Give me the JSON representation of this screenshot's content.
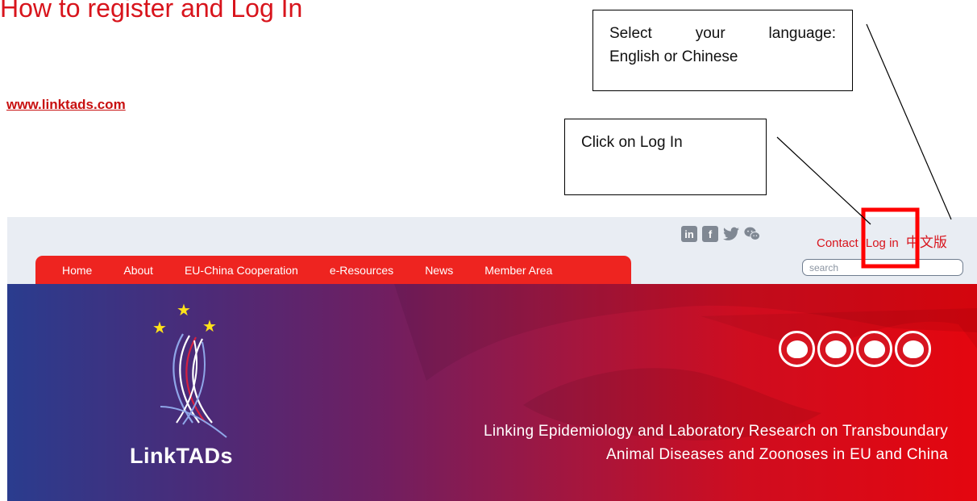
{
  "doc": {
    "title": "How to register and Log In",
    "link": "www.linktads.com"
  },
  "callouts": {
    "language": {
      "line1": [
        "Select",
        "your",
        "language:"
      ],
      "line2": "English or Chinese"
    },
    "login": "Click on Log In"
  },
  "site": {
    "social": [
      {
        "icon": "linkedin-icon",
        "glyph": "in"
      },
      {
        "icon": "facebook-icon",
        "glyph": "f"
      },
      {
        "icon": "twitter-icon",
        "glyph": "🐦"
      },
      {
        "icon": "wechat-icon",
        "glyph": "☁"
      }
    ],
    "toplinks": {
      "contact": "Contact",
      "login": "Log in",
      "chinese": "中文版"
    },
    "search_placeholder": "search",
    "nav": [
      "Home",
      "About",
      "EU-China Cooperation",
      "e-Resources",
      "News",
      "Member Area"
    ],
    "logo": "LinkTADs",
    "tagline": {
      "line1": "Linking Epidemiology and Laboratory Research on Transboundary",
      "line2": "Animal Diseases and Zoonoses in EU and China"
    },
    "animal_icons": [
      "cattle-icon",
      "poultry-icon",
      "pig-icon",
      "sheep-icon"
    ]
  },
  "colors": {
    "accent_red": "#d8141c",
    "nav_red": "#ee2420",
    "highlight_red": "#ff0000",
    "hero_blue": "#2a3c8e",
    "logo_star": "#ffe21a"
  }
}
